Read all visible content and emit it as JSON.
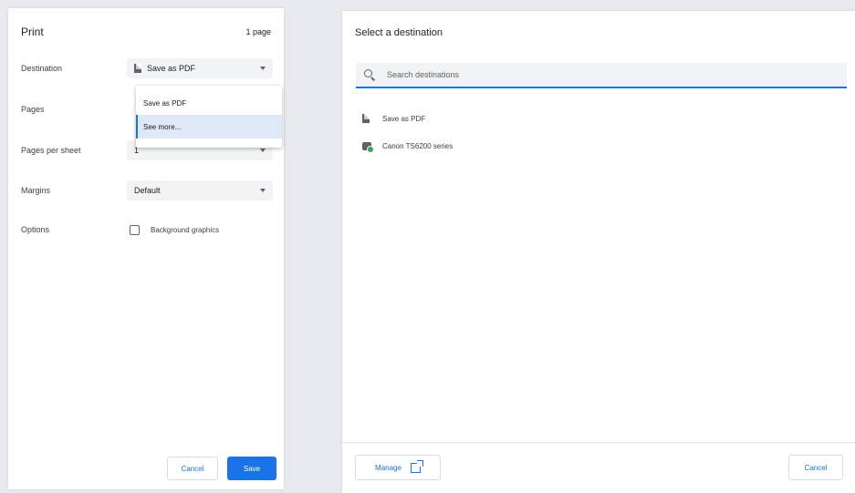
{
  "print": {
    "title": "Print",
    "page_count": "1 page",
    "destination": {
      "label": "Destination",
      "selected": "Save as PDF",
      "options": [
        "Save as PDF",
        "See more..."
      ]
    },
    "pages": {
      "label": "Pages"
    },
    "pages_per_sheet": {
      "label": "Pages per sheet",
      "value": "1"
    },
    "margins": {
      "label": "Margins",
      "value": "Default"
    },
    "options": {
      "label": "Options",
      "checkbox_label": "Background graphics",
      "checked": false
    },
    "cancel_label": "Cancel",
    "save_label": "Save"
  },
  "destination_dialog": {
    "title": "Select a destination",
    "search_placeholder": "Search destinations",
    "items": [
      {
        "label": "Save as PDF",
        "icon": "pdf-icon"
      },
      {
        "label": "Canon TS6200 series",
        "icon": "printer-icon"
      }
    ],
    "manage_label": "Manage",
    "cancel_label": "Cancel"
  },
  "colors": {
    "accent": "#1a73e8",
    "background": "#e8eaed",
    "panel": "#ffffff"
  }
}
